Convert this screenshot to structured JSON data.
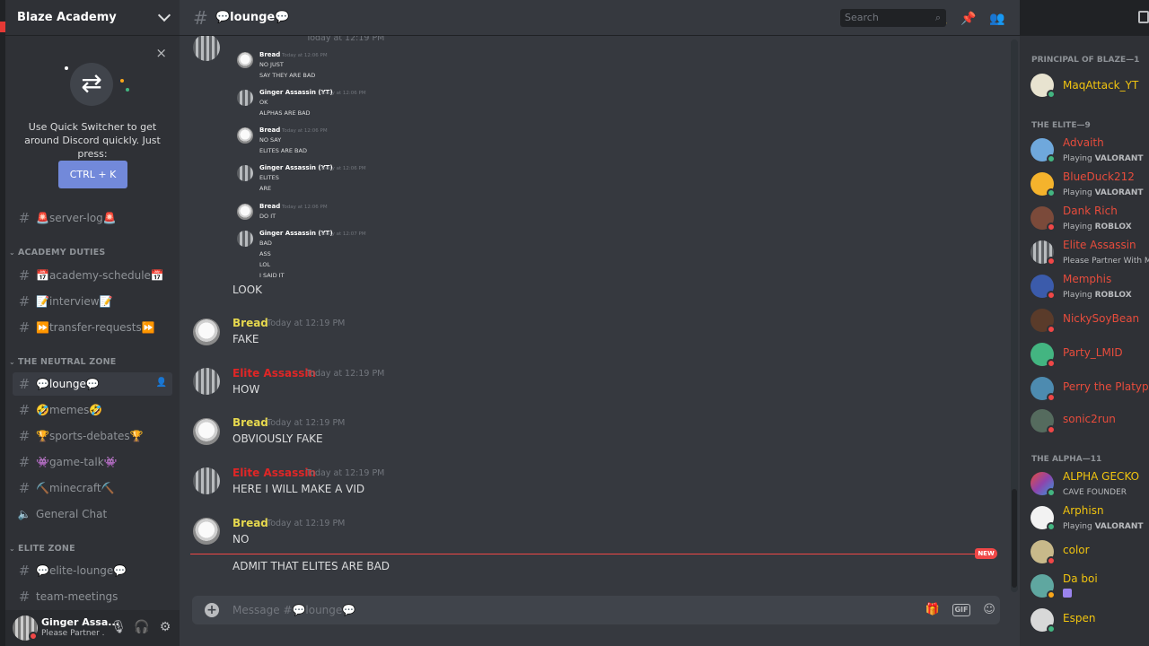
{
  "server": {
    "name": "Blaze Academy"
  },
  "quick_switcher": {
    "text": "Use Quick Switcher to get around Discord quickly. Just press:",
    "shortcut": "CTRL + K",
    "close_glyph": "×",
    "icon_glyph": "⇄"
  },
  "sidebar": {
    "channels_top": [
      {
        "label": "🚨server-log🚨"
      }
    ],
    "categories": [
      {
        "name": "ACADEMY DUTIES",
        "channels": [
          {
            "label": "📅academy-schedule📅"
          },
          {
            "label": "📝interview📝"
          },
          {
            "label": "⏩transfer-requests⏩"
          }
        ]
      },
      {
        "name": "THE NEUTRAL ZONE",
        "channels": [
          {
            "label": "💬lounge💬"
          },
          {
            "label": "🤣memes🤣"
          },
          {
            "label": "🏆sports-debates🏆"
          },
          {
            "label": "👾game-talk👾"
          },
          {
            "label": "⛏️minecraft⛏️"
          },
          {
            "label": "General Chat"
          }
        ]
      },
      {
        "name": "ELITE ZONE",
        "channels": [
          {
            "label": "💬elite-lounge💬"
          },
          {
            "label": "team-meetings"
          }
        ]
      }
    ]
  },
  "user_panel": {
    "name": "Ginger Assa...",
    "status": "Please Partner ..."
  },
  "channel": {
    "name": "💬lounge💬"
  },
  "search": {
    "placeholder": "Search"
  },
  "screenshot": {
    "header_time": "Today at 12:19 PM",
    "messages": [
      {
        "author": "Bread",
        "time": "Today at 12:06 PM",
        "lines": [
          "NO JUST",
          "SAY THEY ARE BAD"
        ]
      },
      {
        "author": "Ginger Assassin (YT)",
        "time": "Today at 12:06 PM",
        "lines": [
          "OK",
          "ALPHAS ARE BAD"
        ]
      },
      {
        "author": "Bread",
        "time": "Today at 12:06 PM",
        "lines": [
          "NO SAY",
          "ELITES ARE BAD"
        ]
      },
      {
        "author": "Ginger Assassin (YT)",
        "time": "Today at 12:06 PM",
        "lines": [
          "ELITES",
          "ARE"
        ]
      },
      {
        "author": "Bread",
        "time": "Today at 12:06 PM",
        "lines": [
          "DO IT"
        ]
      },
      {
        "author": "Ginger Assassin (YT)",
        "time": "Today at 12:07 PM",
        "lines": [
          "BAD",
          "ASS",
          "LOL",
          "I SAID IT"
        ]
      }
    ]
  },
  "messages": [
    {
      "text": "LOOK"
    },
    {
      "author": "Bread",
      "time": "Today at 12:19 PM",
      "text": "FAKE"
    },
    {
      "author": "Elite Assassin",
      "time": "Today at 12:19 PM",
      "text": "HOW"
    },
    {
      "author": "Bread",
      "time": "Today at 12:19 PM",
      "text": "OBVIOUSLY FAKE"
    },
    {
      "author": "Elite Assassin",
      "time": "Today at 12:19 PM",
      "text": "HERE I WILL MAKE A VID"
    },
    {
      "author": "Bread",
      "time": "Today at 12:19 PM",
      "text": "NO"
    },
    {
      "text": "ADMIT THAT ELITES ARE BAD"
    }
  ],
  "new_badge": "NEW",
  "composer": {
    "placeholder": "Message #💬lounge💬",
    "gif_label": "GIF"
  },
  "members": {
    "groups": [
      {
        "title": "PRINCIPAL OF BLAZE—1",
        "members": [
          {
            "name": "MaqAttack_YT",
            "color": "#f1c40f",
            "activity": "",
            "activity_bold": ""
          }
        ]
      },
      {
        "title": "THE ELITE—9",
        "members": [
          {
            "name": "Advaith",
            "color": "#e74c3c",
            "activity": "Playing ",
            "activity_bold": "VALORANT"
          },
          {
            "name": "BlueDuck212",
            "color": "#e74c3c",
            "activity": "Playing ",
            "activity_bold": "VALORANT"
          },
          {
            "name": "Dank Rich",
            "color": "#e74c3c",
            "activity": "Playing ",
            "activity_bold": "ROBLOX"
          },
          {
            "name": "Elite Assassin",
            "color": "#e74c3c",
            "activity": "Please Partner With Me",
            "activity_bold": ""
          },
          {
            "name": "Memphis",
            "color": "#e74c3c",
            "activity": "Playing ",
            "activity_bold": "ROBLOX"
          },
          {
            "name": "NickySoyBean",
            "color": "#e74c3c",
            "activity": "",
            "activity_bold": ""
          },
          {
            "name": "Party_LMID",
            "color": "#e74c3c",
            "activity": "",
            "activity_bold": ""
          },
          {
            "name": "Perry the Platypus",
            "color": "#e74c3c",
            "activity": "",
            "activity_bold": ""
          },
          {
            "name": "sonic2run",
            "color": "#e74c3c",
            "activity": "",
            "activity_bold": ""
          }
        ]
      },
      {
        "title": "THE ALPHA—11",
        "members": [
          {
            "name": "ALPHA GECKO",
            "color": "#f1c40f",
            "activity": "CAVE FOUNDER",
            "activity_bold": ""
          },
          {
            "name": "Arphisn",
            "color": "#f1c40f",
            "activity": "Playing ",
            "activity_bold": "VALORANT"
          },
          {
            "name": "color",
            "color": "#f1c40f",
            "activity": "",
            "activity_bold": ""
          },
          {
            "name": "Da boi",
            "color": "#f1c40f",
            "activity": "",
            "activity_bold": ""
          },
          {
            "name": "Espen",
            "color": "#f1c40f",
            "activity": "",
            "activity_bold": ""
          }
        ]
      }
    ]
  },
  "colors": {
    "bread": "#e6d84e",
    "elite": "#e02626",
    "accent": "#7289da",
    "new": "#f04747"
  }
}
